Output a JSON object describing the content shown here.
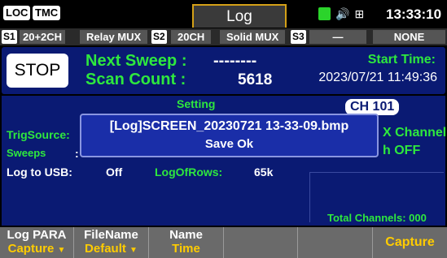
{
  "topbar": {
    "loc_label": "LOC",
    "tmc_label": "TMC",
    "active_tab": "Log",
    "clock": "13:33:10"
  },
  "slots": [
    {
      "num": "S1",
      "config": "20+2CH",
      "module": "Relay MUX"
    },
    {
      "num": "S2",
      "config": "20CH",
      "module": "Solid MUX"
    },
    {
      "num": "S3",
      "config": "—",
      "module": "NONE"
    }
  ],
  "status": {
    "stop_label": "STOP",
    "next_sweep_label": "Next Sweep  :",
    "next_sweep_value": "--------",
    "scan_count_label": "Scan Count  :",
    "scan_count_value": "5618",
    "start_time_label": "Start Time:",
    "start_time_value": "2023/07/21 11:49:36"
  },
  "main": {
    "setting_label": "Setting",
    "channel_badge": "CH 101",
    "trig_source_label": "TrigSource:",
    "sweeps_label": "Sweeps",
    "sweeps_colon": ":",
    "log_to_usb_label": "Log to USB:",
    "log_to_usb_value": "Off",
    "log_of_rows_label": "LogOfRows:",
    "log_of_rows_value": "65k",
    "x_channel_label": "X Channel",
    "h_off_label": "h OFF",
    "total_channels_label": "Total Channels: 000"
  },
  "popup": {
    "line1": "[Log]SCREEN_20230721 13-33-09.bmp",
    "line2": "Save Ok"
  },
  "softkeys": [
    {
      "top": "Log PARA",
      "bottom": "Capture"
    },
    {
      "top": "FileName",
      "bottom": "Default"
    },
    {
      "top": "Name",
      "bottom": "Time"
    },
    {
      "top": "",
      "bottom": ""
    },
    {
      "top": "",
      "bottom": ""
    },
    {
      "single": "Capture"
    }
  ],
  "colors": {
    "panel_blue": "#0a1a73",
    "label_green": "#2ee83e",
    "softkey_yellow": "#ffcc00",
    "tab_border": "#d4a017"
  }
}
